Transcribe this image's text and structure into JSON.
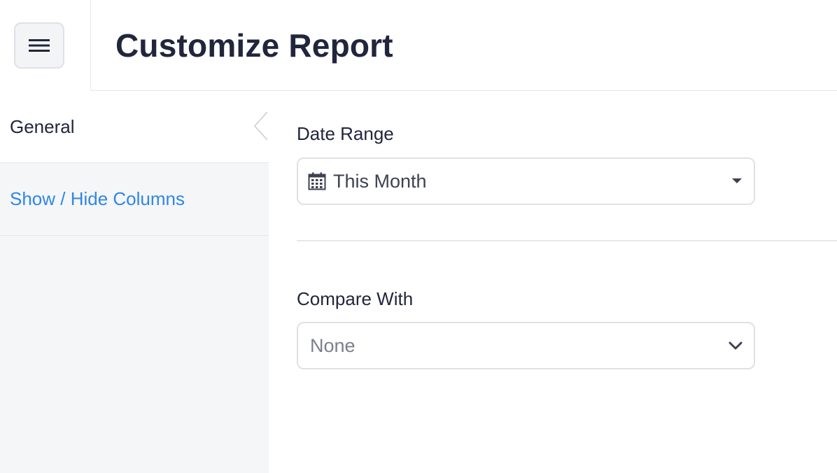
{
  "header": {
    "title": "Customize Report"
  },
  "menu": {
    "icon": "hamburger-menu-icon"
  },
  "sidebar": {
    "items": [
      {
        "label": "General",
        "active": true
      },
      {
        "label": "Show / Hide Columns",
        "active": false
      }
    ],
    "collapse_icon": "chevron-left-icon"
  },
  "main": {
    "date_range": {
      "label": "Date Range",
      "value": "This Month",
      "icon": "calendar-icon"
    },
    "compare_with": {
      "label": "Compare With",
      "value": "None"
    }
  },
  "colors": {
    "link": "#2f87e8",
    "text": "#21263c",
    "sidebar_bg": "#f5f6f8",
    "border": "#dfe1e6"
  }
}
